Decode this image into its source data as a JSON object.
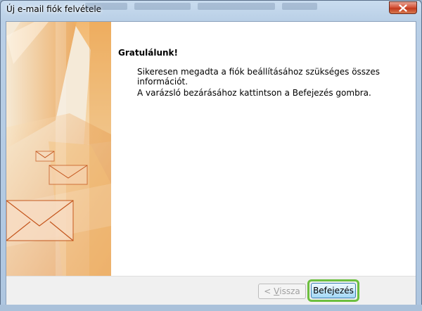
{
  "window": {
    "title": "Új e-mail fiók felvétele",
    "close_symbol": "✕"
  },
  "content": {
    "heading": "Gratulálunk!",
    "line1": "Sikeresen megadta a fiók beállításához szükséges összes információt.",
    "line2": "A varázsló bezárásához kattintson a Befejezés gombra."
  },
  "buttons": {
    "back_prefix": "< ",
    "back_underlined": "V",
    "back_rest": "issza",
    "finish": "Befejezés"
  },
  "colors": {
    "accent_orange": "#e88a2c",
    "highlight_green": "#6cbf3f"
  },
  "icons": {
    "close": "close-icon",
    "envelope": "envelope-icon"
  }
}
